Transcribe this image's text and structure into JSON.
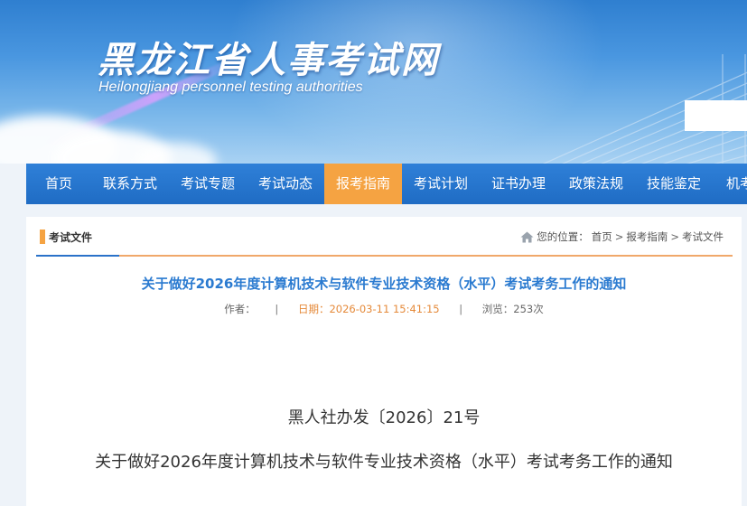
{
  "header": {
    "title": "黑龙江省人事考试网",
    "subtitle": "Heilongjiang personnel testing authorities"
  },
  "nav": {
    "items": [
      {
        "label": "首页"
      },
      {
        "label": "联系方式"
      },
      {
        "label": "考试专题"
      },
      {
        "label": "考试动态"
      },
      {
        "label": "报考指南",
        "active": true
      },
      {
        "label": "考试计划"
      },
      {
        "label": "证书办理"
      },
      {
        "label": "政策法规"
      },
      {
        "label": "技能鉴定"
      },
      {
        "label": "机考"
      }
    ]
  },
  "section": {
    "tab_label": "考试文件",
    "breadcrumb": {
      "prefix": "您的位置：",
      "items": [
        "首页",
        "报考指南",
        "考试文件"
      ],
      "separator": ">"
    }
  },
  "article": {
    "title": "关于做好2026年度计算机技术与软件专业技术资格（水平）考试考务工作的通知",
    "meta": {
      "author": "作者：",
      "date": "日期：2026-03-11 15:41:15",
      "views": "浏览：253次"
    },
    "doc_number": "黑人社办发〔2026〕21号",
    "doc_title": "关于做好2026年度计算机技术与软件专业技术资格（水平）考试考务工作的通知"
  },
  "colors": {
    "nav_bg": "#1f6cc4",
    "nav_active": "#f5a342",
    "title_blue": "#2a7ad0",
    "date_orange": "#e58a3a"
  }
}
